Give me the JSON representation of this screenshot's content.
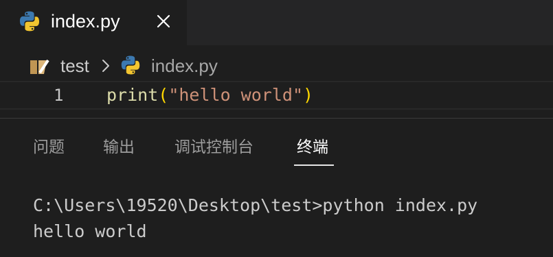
{
  "tab": {
    "label": "index.py",
    "icon": "python-icon",
    "close_icon": "close-icon"
  },
  "breadcrumb": {
    "folder": {
      "label": "test",
      "icon": "folder-icon"
    },
    "separator_icon": "chevron-right-icon",
    "file": {
      "label": "index.py",
      "icon": "python-icon"
    }
  },
  "editor": {
    "line_number": "1",
    "code": {
      "fn": "print",
      "open_paren": "(",
      "string": "\"hello world\"",
      "close_paren": ")"
    }
  },
  "panel": {
    "tabs": [
      {
        "label": "问题",
        "active": false
      },
      {
        "label": "输出",
        "active": false
      },
      {
        "label": "调试控制台",
        "active": false
      },
      {
        "label": "终端",
        "active": true
      }
    ]
  },
  "terminal": {
    "lines": [
      "C:\\Users\\19520\\Desktop\\test>python index.py",
      "hello world"
    ]
  },
  "colors": {
    "background": "#1e1e1e",
    "tabbar": "#252526",
    "function": "#dcdcaa",
    "bracket": "#ffd700",
    "string": "#ce9178",
    "python_blue": "#3c79b0",
    "python_yellow": "#f2c530"
  }
}
